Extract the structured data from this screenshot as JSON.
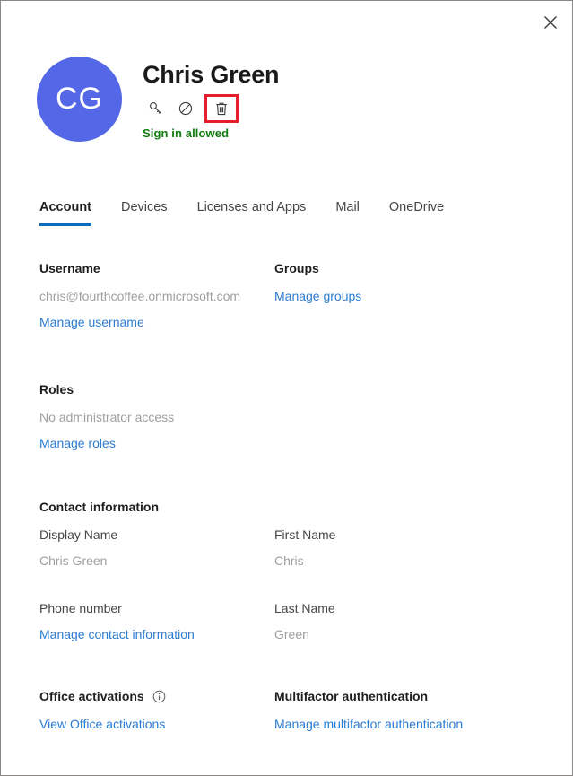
{
  "window": {
    "close_label": "Close",
    "close_icon": "close-icon"
  },
  "header": {
    "avatar_initials": "CG",
    "avatar_color": "#5468e7",
    "user_name": "Chris Green",
    "signin_status": "Sign in allowed",
    "signin_status_color": "#107c10",
    "highlight_color": "#e81d2b",
    "actions": [
      {
        "name": "reset-password-icon",
        "icon": "key-icon",
        "label": "Reset password",
        "highlighted": false
      },
      {
        "name": "block-signin-icon",
        "icon": "block-icon",
        "label": "Block sign-in",
        "highlighted": false
      },
      {
        "name": "delete-user-icon",
        "icon": "trash-icon",
        "label": "Delete user",
        "highlighted": true
      }
    ]
  },
  "tabs": [
    {
      "label": "Account",
      "active": true
    },
    {
      "label": "Devices",
      "active": false
    },
    {
      "label": "Licenses and Apps",
      "active": false
    },
    {
      "label": "Mail",
      "active": false
    },
    {
      "label": "OneDrive",
      "active": false
    }
  ],
  "account": {
    "username": {
      "title": "Username",
      "value": "chris@fourthcoffee.onmicrosoft.com",
      "link": "Manage username"
    },
    "groups": {
      "title": "Groups",
      "link": "Manage groups"
    },
    "roles": {
      "title": "Roles",
      "value": "No administrator access",
      "link": "Manage roles"
    },
    "contact": {
      "title": "Contact information",
      "display_name_label": "Display Name",
      "display_name_value": "Chris Green",
      "first_name_label": "First Name",
      "first_name_value": "Chris",
      "phone_label": "Phone number",
      "phone_value": "",
      "last_name_label": "Last Name",
      "last_name_value": "Green",
      "link": "Manage contact information"
    },
    "office_activations": {
      "title": "Office activations",
      "info_icon": "info-icon",
      "link": "View Office activations"
    },
    "mfa": {
      "title": "Multifactor authentication",
      "link": "Manage multifactor authentication"
    }
  },
  "colors": {
    "link": "#2b7cd3",
    "tab_active_underline": "#0f6cbd",
    "value_text": "#a19f9d",
    "label_text": "#484644",
    "heading_text": "#201f1e"
  }
}
